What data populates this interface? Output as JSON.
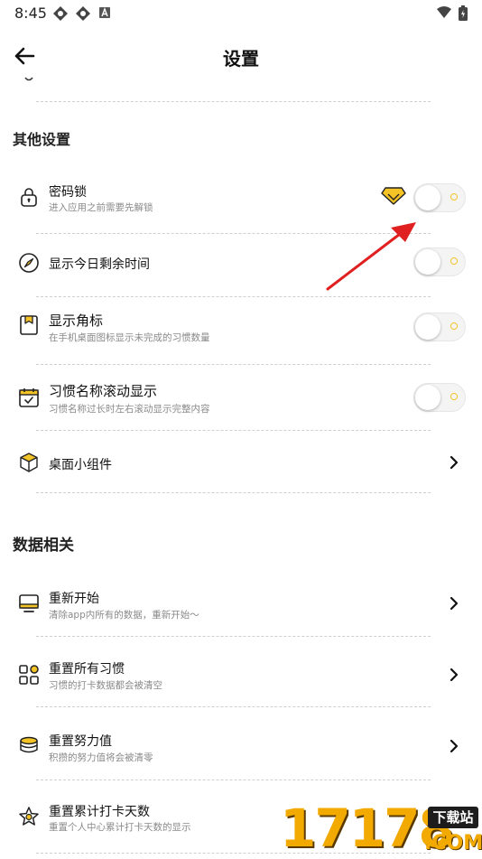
{
  "status_bar": {
    "time": "8:45"
  },
  "header": {
    "title": "设置"
  },
  "sections": {
    "other": "其他设置",
    "data": "数据相关"
  },
  "rows": [
    {
      "title": "密码锁",
      "subtitle": "进入应用之前需要先解锁",
      "icon": "lock-icon",
      "control": "toggle",
      "toggled": false,
      "premium": true
    },
    {
      "title": "显示今日剩余时间",
      "subtitle": "",
      "icon": "compass-icon",
      "control": "toggle",
      "toggled": false
    },
    {
      "title": "显示角标",
      "subtitle": "在手机桌面图标显示未完成的习惯数量",
      "icon": "badge-icon",
      "control": "toggle",
      "toggled": false
    },
    {
      "title": "习惯名称滚动显示",
      "subtitle": "习惯名称过长时左右滚动显示完整内容",
      "icon": "calendar-check-icon",
      "control": "toggle",
      "toggled": false
    },
    {
      "title": "桌面小组件",
      "subtitle": "",
      "icon": "cube-icon",
      "control": "chevron"
    },
    {
      "title": "重新开始",
      "subtitle": "清除app内所有的数据，重新开始～",
      "icon": "monitor-icon",
      "control": "chevron"
    },
    {
      "title": "重置所有习惯",
      "subtitle": "习惯的打卡数据都会被清空",
      "icon": "grid-icon",
      "control": "chevron"
    },
    {
      "title": "重置努力值",
      "subtitle": "积攒的努力值将会被清零",
      "icon": "coins-icon",
      "control": "chevron"
    },
    {
      "title": "重置累计打卡天数",
      "subtitle": "重置个人中心累计打卡天数的显示",
      "icon": "star-icon",
      "control": "chevron"
    }
  ],
  "watermark": {
    "number": "17178",
    "top": "下载站",
    "bottom": ".COM"
  },
  "colors": {
    "accent": "#f4c427",
    "annotation": "#e02020"
  }
}
